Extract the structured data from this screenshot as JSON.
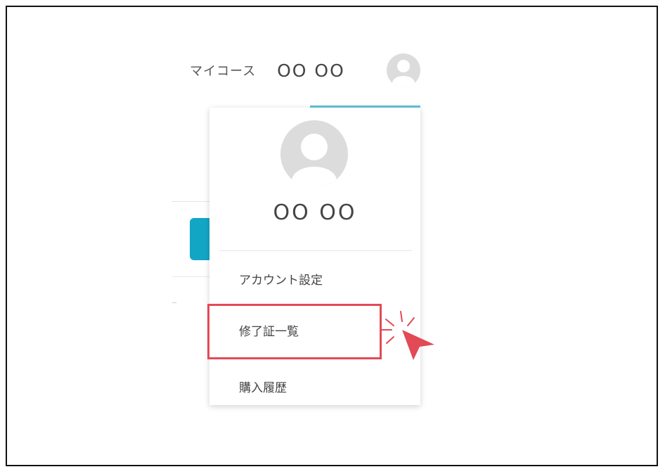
{
  "header": {
    "my_course_label": "マイコース",
    "user_name": "OO OO",
    "avatar_icon": "user-avatar-icon",
    "active_underline_color": "#5fc4d6"
  },
  "background": {
    "accent_button_color": "#13a6c4"
  },
  "dropdown": {
    "avatar_icon": "user-avatar-icon",
    "user_name": "OO OO",
    "items": [
      {
        "label": "アカウント設定"
      },
      {
        "label": "修了証一覧"
      },
      {
        "label": "購入履歴"
      }
    ]
  },
  "annotation": {
    "highlight_color": "#e24a56",
    "highlighted_item": "修了証一覧",
    "pointer_icon": "click-pointer-icon"
  }
}
